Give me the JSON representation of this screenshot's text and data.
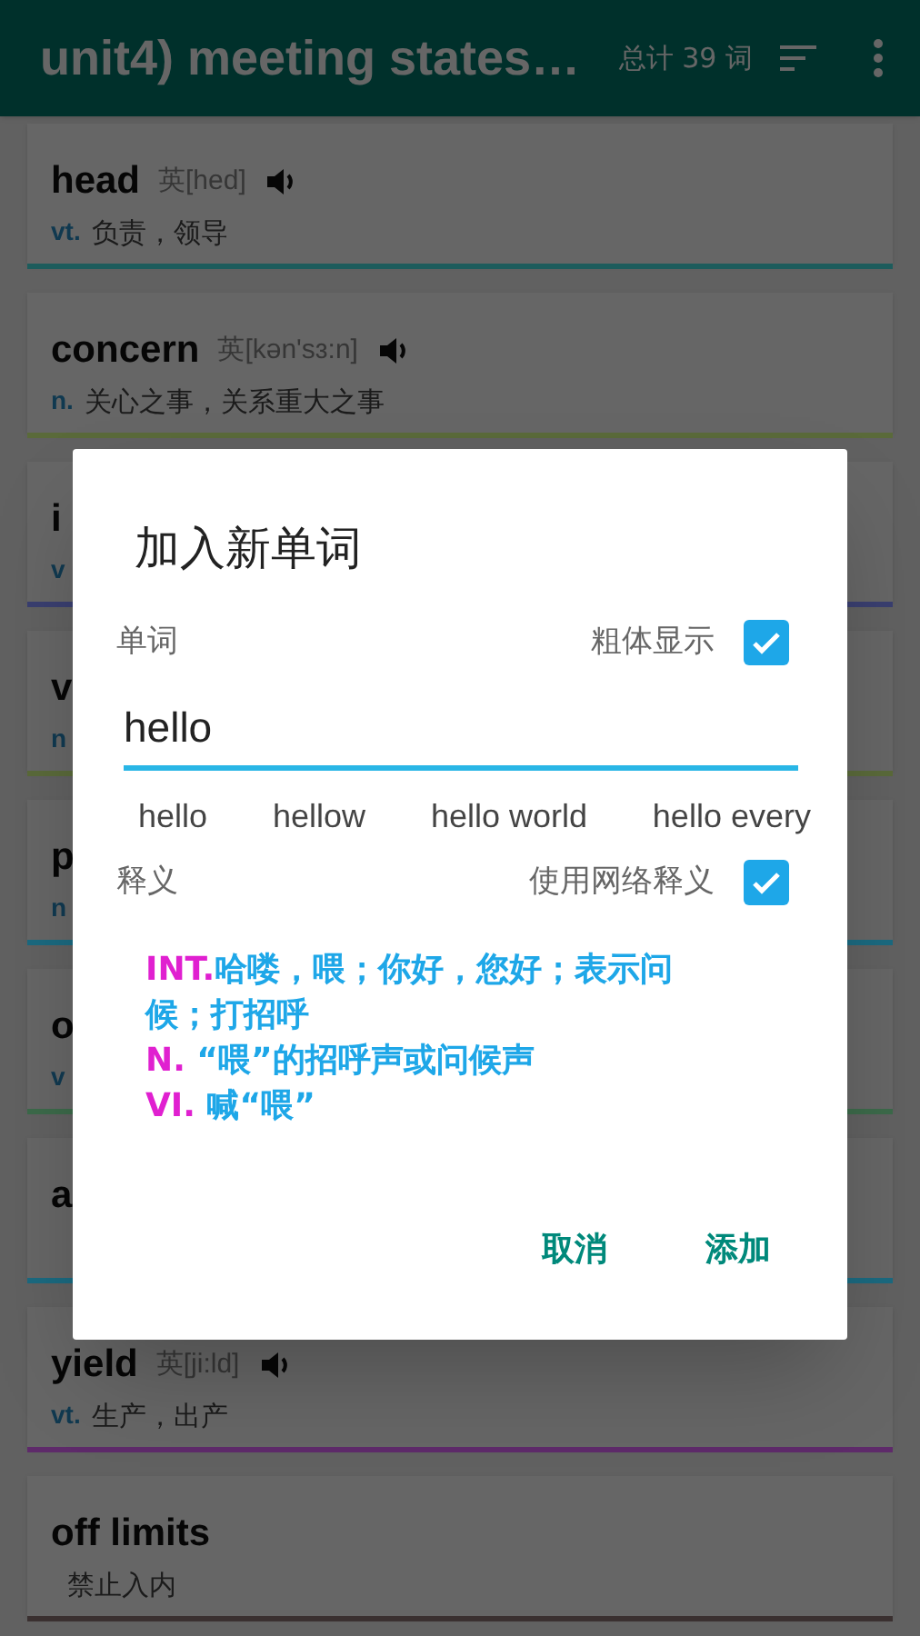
{
  "app_bar": {
    "title": "unit4) meeting states…",
    "count": "总计 39 词"
  },
  "words": [
    {
      "word": "head",
      "phonetic": "英[hed]",
      "pos": "vt.",
      "meaning": "负责，领导",
      "color": "#1d5c5c"
    },
    {
      "word": "concern",
      "phonetic": "英[kən'sɜ:n]",
      "pos": "n.",
      "meaning": "关心之事，关系重大之事",
      "color": "#5a6a3a"
    },
    {
      "word": "i",
      "pos": "v",
      "color": "#3a3f70"
    },
    {
      "word": "v",
      "pos": "n",
      "color": "#5a6a3a"
    },
    {
      "word": "p",
      "pos": "n",
      "color": "#1b6a80"
    },
    {
      "word": "o",
      "pos": "v",
      "color": "#3c6a4a"
    },
    {
      "word": "a",
      "color": "#1b6a80"
    },
    {
      "word": "yield",
      "phonetic": "英[ji:ld]",
      "pos": "vt.",
      "meaning": "生产，出产",
      "color": "#5e2a6a"
    },
    {
      "word": "off limits",
      "meaning": "禁止入内",
      "color": "#3a3030"
    }
  ],
  "dialog": {
    "title": "加入新单词",
    "word_label": "单词",
    "bold_option": {
      "label": "粗体显示",
      "checked": true
    },
    "input": {
      "value": "hello"
    },
    "suggestions": [
      "hello",
      "hellow",
      "hello world",
      "hello every"
    ],
    "meaning_label": "释义",
    "web_option": {
      "label": "使用网络释义",
      "checked": true
    },
    "definitions": [
      {
        "pos": "INT.",
        "text": "哈喽，喂；你好，您好；表示问候；打招呼"
      },
      {
        "pos": "N.",
        "text": " “喂”的招呼声或问候声"
      },
      {
        "pos": "VI.",
        "text": " 喊“喂”"
      }
    ],
    "buttons": [
      "取消",
      "添加"
    ]
  }
}
